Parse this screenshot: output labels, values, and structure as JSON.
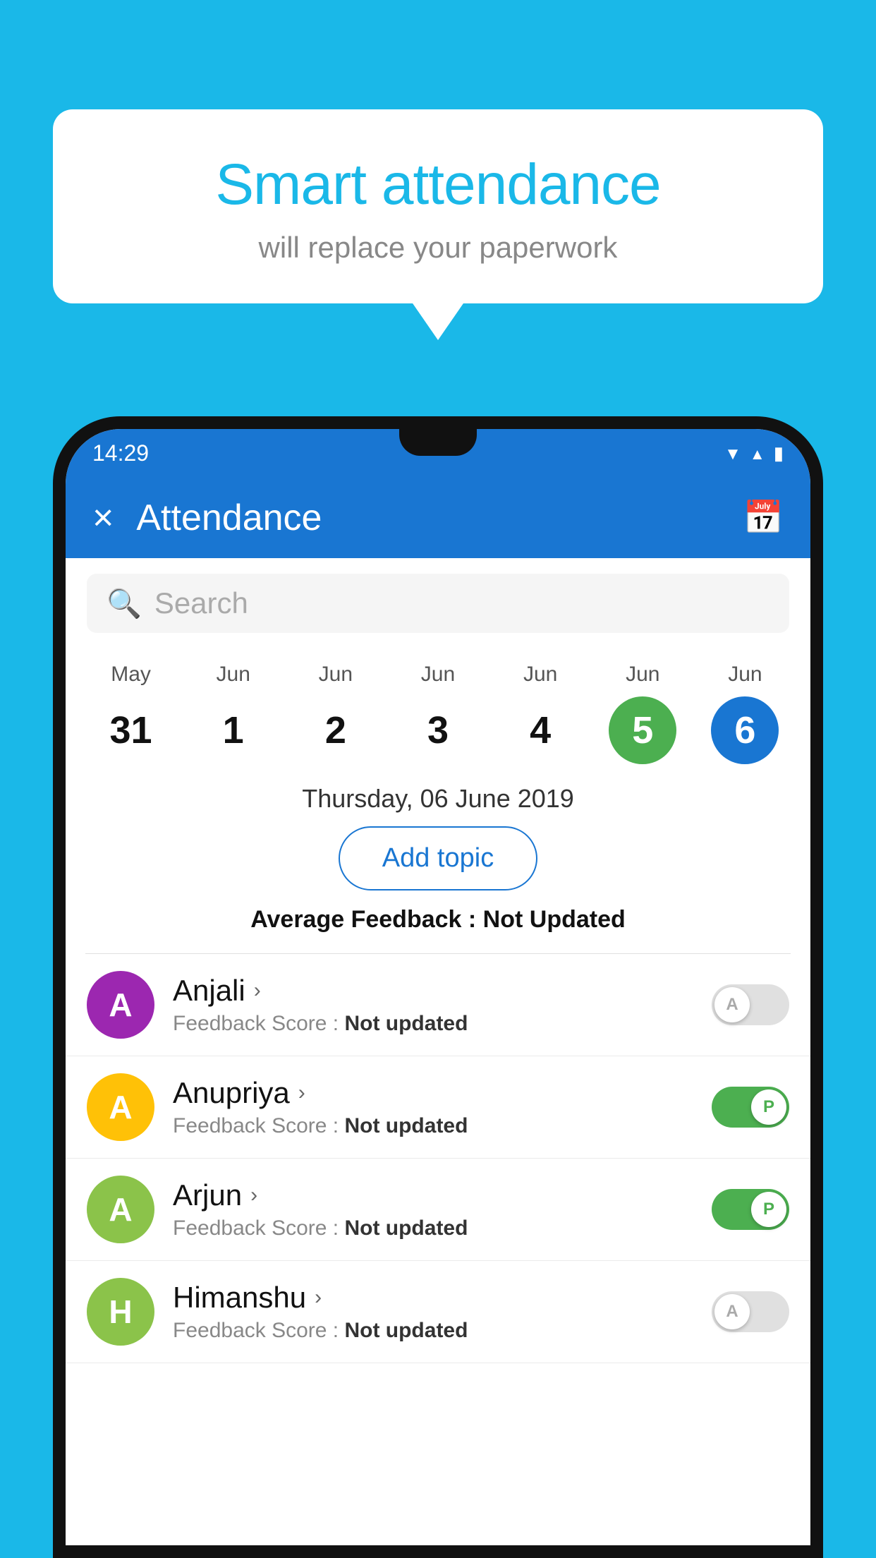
{
  "background_color": "#1ab8e8",
  "speech_bubble": {
    "title": "Smart attendance",
    "subtitle": "will replace your paperwork"
  },
  "status_bar": {
    "time": "14:29"
  },
  "app_bar": {
    "title": "Attendance",
    "close_label": "×",
    "calendar_icon": "calendar-icon"
  },
  "search": {
    "placeholder": "Search"
  },
  "date_strip": {
    "columns": [
      {
        "month": "May",
        "day": "31",
        "state": "normal"
      },
      {
        "month": "Jun",
        "day": "1",
        "state": "normal"
      },
      {
        "month": "Jun",
        "day": "2",
        "state": "normal"
      },
      {
        "month": "Jun",
        "day": "3",
        "state": "normal"
      },
      {
        "month": "Jun",
        "day": "4",
        "state": "normal"
      },
      {
        "month": "Jun",
        "day": "5",
        "state": "today"
      },
      {
        "month": "Jun",
        "day": "6",
        "state": "selected"
      }
    ]
  },
  "selected_date_label": "Thursday, 06 June 2019",
  "add_topic_label": "Add topic",
  "average_feedback": {
    "label": "Average Feedback : ",
    "value": "Not Updated"
  },
  "students": [
    {
      "name": "Anjali",
      "initial": "A",
      "color": "#9c27b0",
      "feedback_label": "Feedback Score : ",
      "feedback_value": "Not updated",
      "toggle": "off",
      "toggle_letter": "A"
    },
    {
      "name": "Anupriya",
      "initial": "A",
      "color": "#ffc107",
      "feedback_label": "Feedback Score : ",
      "feedback_value": "Not updated",
      "toggle": "on",
      "toggle_letter": "P"
    },
    {
      "name": "Arjun",
      "initial": "A",
      "color": "#8bc34a",
      "feedback_label": "Feedback Score : ",
      "feedback_value": "Not updated",
      "toggle": "on",
      "toggle_letter": "P"
    },
    {
      "name": "Himanshu",
      "initial": "H",
      "color": "#8bc34a",
      "feedback_label": "Feedback Score : ",
      "feedback_value": "Not updated",
      "toggle": "off",
      "toggle_letter": "A"
    }
  ]
}
